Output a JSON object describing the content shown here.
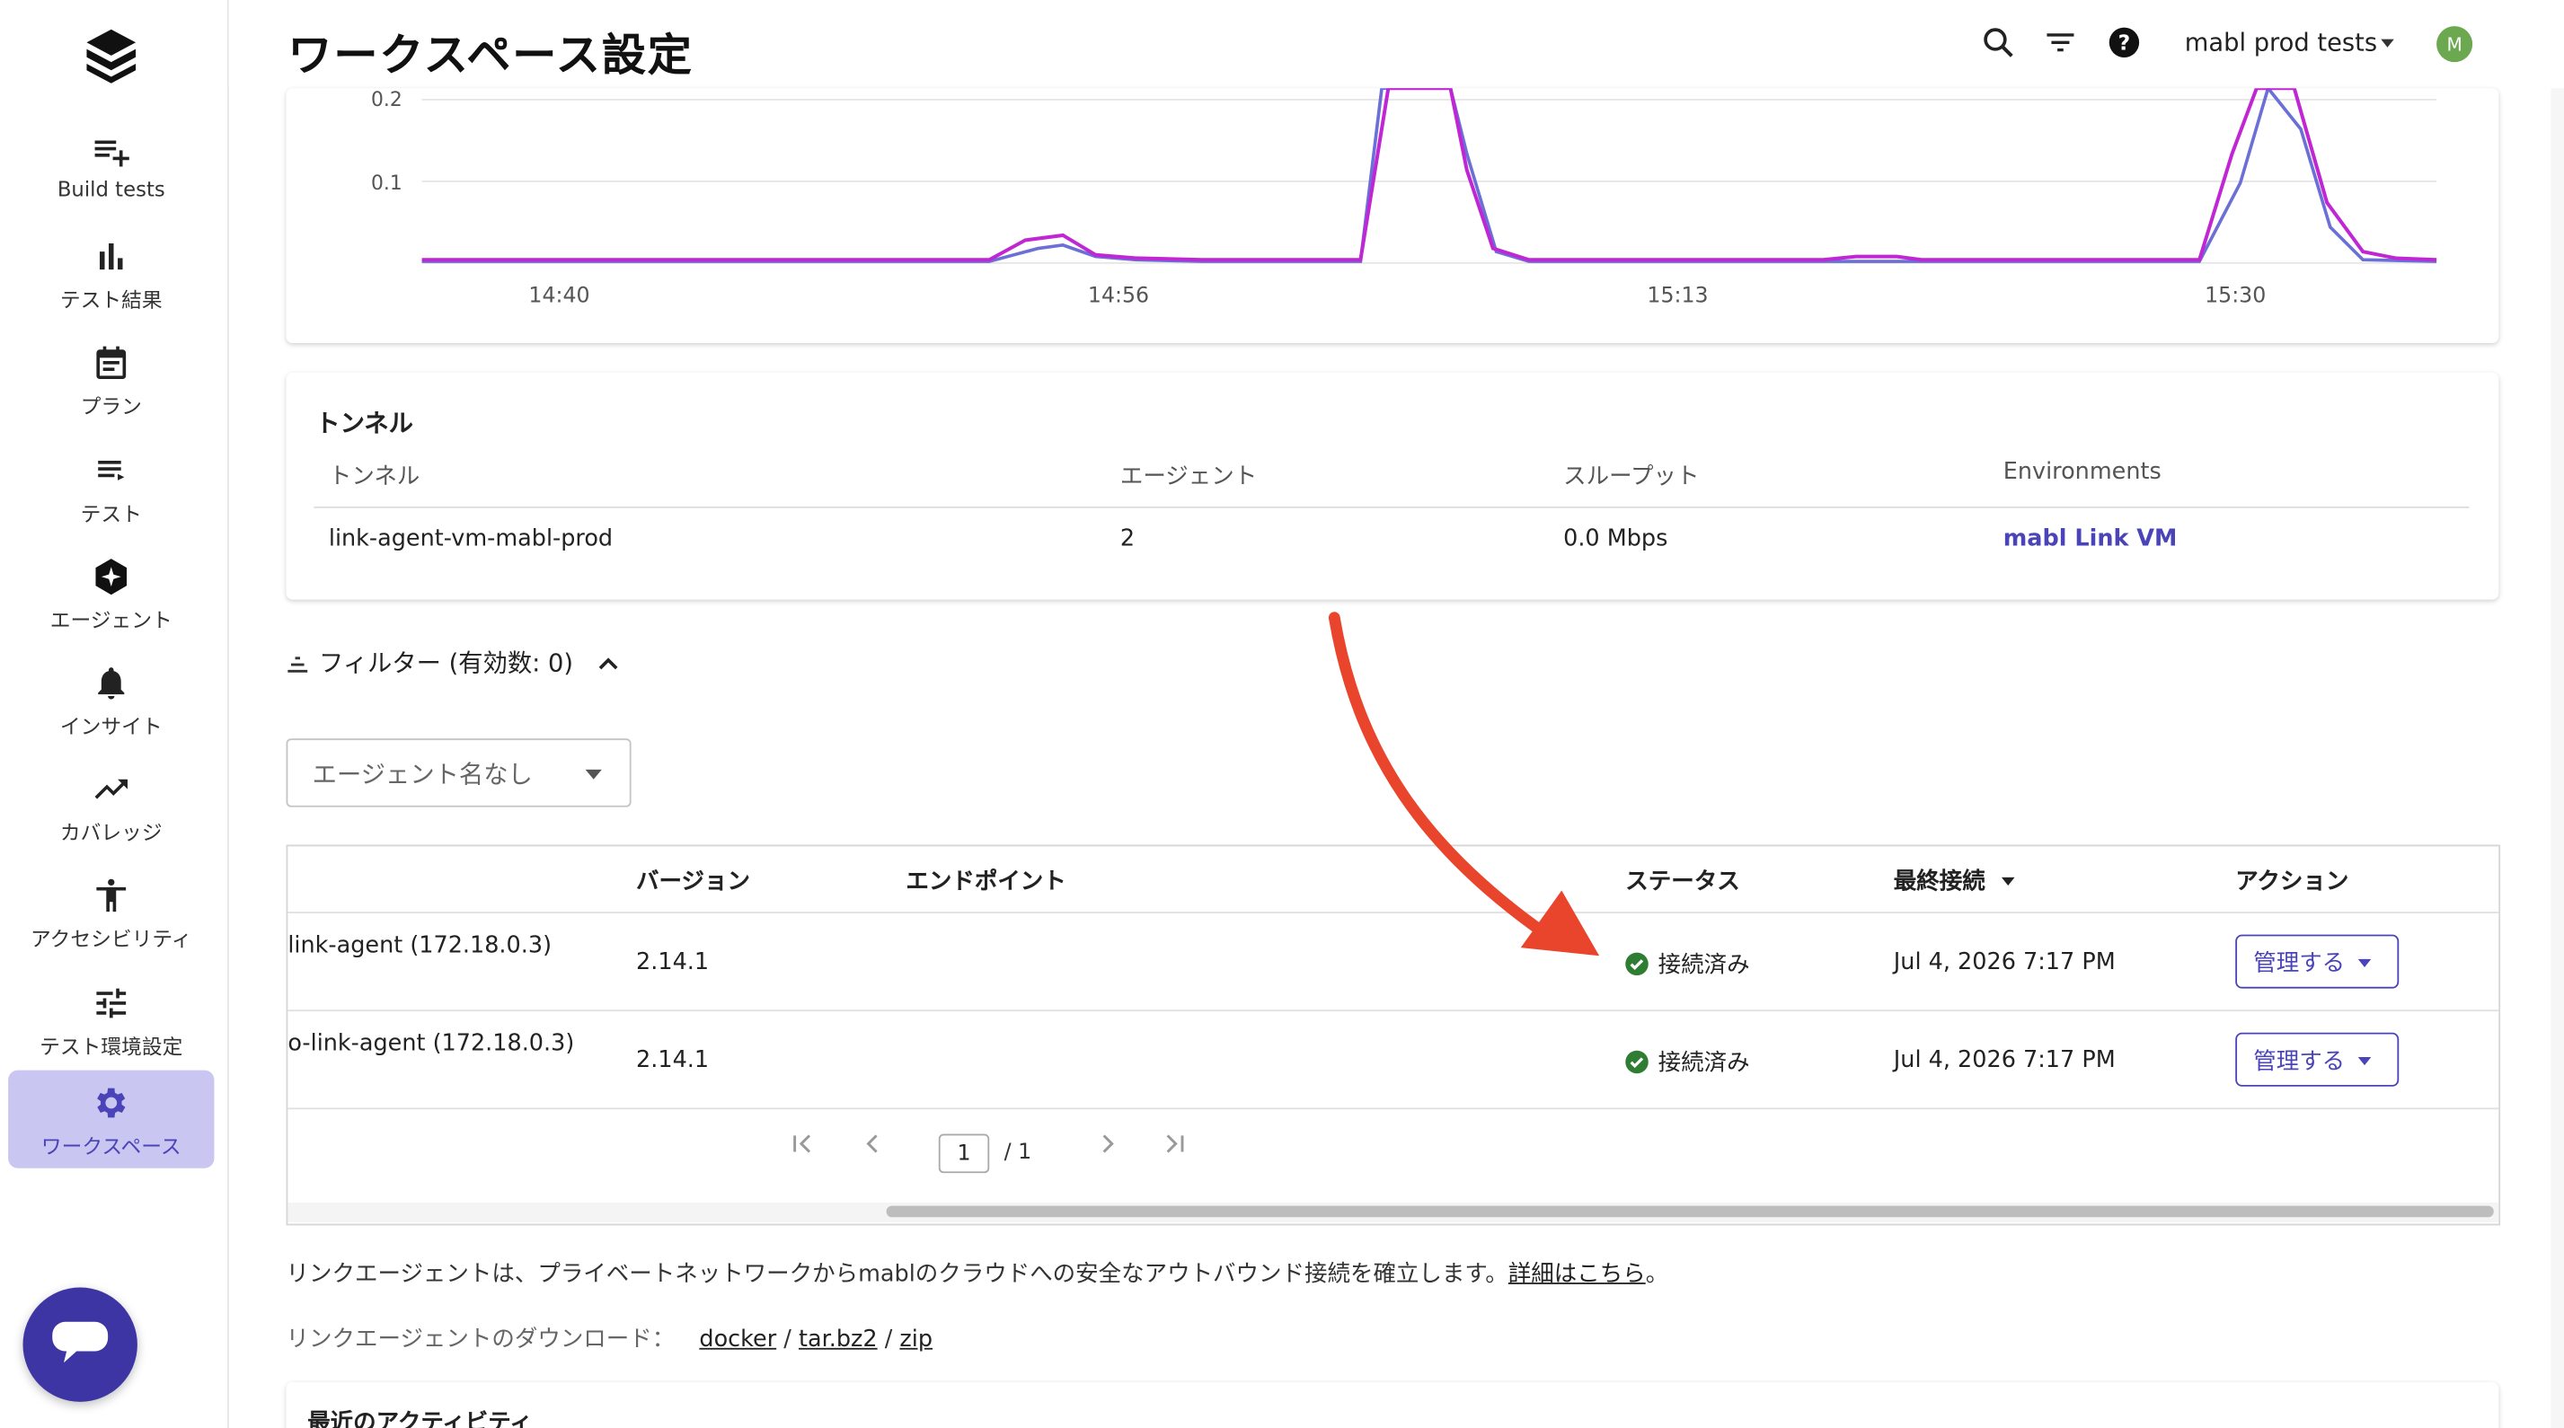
{
  "sidebar": {
    "items": [
      {
        "label": "Build tests",
        "icon": "build-tests-icon"
      },
      {
        "label": "テスト結果",
        "icon": "bar-chart-icon"
      },
      {
        "label": "プラン",
        "icon": "calendar-icon"
      },
      {
        "label": "テスト",
        "icon": "list-icon"
      },
      {
        "label": "エージェント",
        "icon": "agent-icon"
      },
      {
        "label": "インサイト",
        "icon": "bell-icon"
      },
      {
        "label": "カバレッジ",
        "icon": "trending-up-icon"
      },
      {
        "label": "アクセシビリティ",
        "icon": "accessibility-icon"
      },
      {
        "label": "テスト環境設定",
        "icon": "tune-icon"
      },
      {
        "label": "ワークスペース",
        "icon": "gear-icon",
        "active": true
      }
    ]
  },
  "header": {
    "title": "ワークスペース設定",
    "workspace": "mabl prod tests",
    "avatar_initial": "M"
  },
  "chart_data": {
    "type": "line",
    "x_ticks": [
      "14:40",
      "14:56",
      "15:13",
      "15:30"
    ],
    "y_ticks": [
      "0.2",
      "0.1"
    ],
    "series": [
      {
        "color": "#c026d3"
      },
      {
        "color": "#6b6fd6"
      }
    ]
  },
  "tunnel": {
    "title": "トンネル",
    "columns": [
      "トンネル",
      "エージェント",
      "スループット",
      "Environments"
    ],
    "row": {
      "name": "link-agent-vm-mabl-prod",
      "agents": "2",
      "throughput": "0.0 Mbps",
      "environment": "mabl Link VM"
    }
  },
  "filter": {
    "label": "フィルター (有効数: 0)",
    "agent_select": "エージェント名なし"
  },
  "agents_table": {
    "columns": {
      "version": "バージョン",
      "endpoint": "エンドポイント",
      "status": "ステータス",
      "last_connected": "最終接続",
      "action": "アクション"
    },
    "rows": [
      {
        "name": "link-agent (172.18.0.3)",
        "version": "2.14.1",
        "endpoint": "",
        "status": "接続済み",
        "last_connected": "Jul 4, 2026 7:17 PM",
        "action": "管理する"
      },
      {
        "name": "o-link-agent (172.18.0.3)",
        "version": "2.14.1",
        "endpoint": "",
        "status": "接続済み",
        "last_connected": "Jul 4, 2026 7:17 PM",
        "action": "管理する"
      }
    ],
    "pagination": {
      "current": "1",
      "total": "/ 1"
    }
  },
  "info": {
    "description_prefix": "リンクエージェントは、プライベートネットワークからmablのクラウドへの安全なアウトバウンド接続を確立します。",
    "details_link": "詳細はこちら",
    "description_suffix": "。",
    "download_label": "リンクエージェントのダウンロード：",
    "downloads": [
      "docker",
      "tar.bz2",
      "zip"
    ],
    "separator": " / "
  },
  "activity": {
    "title": "最近のアクティビティ"
  },
  "colors": {
    "accent": "#4a44b8",
    "arrow": "#e8452c",
    "status_ok": "#2e7d32"
  }
}
